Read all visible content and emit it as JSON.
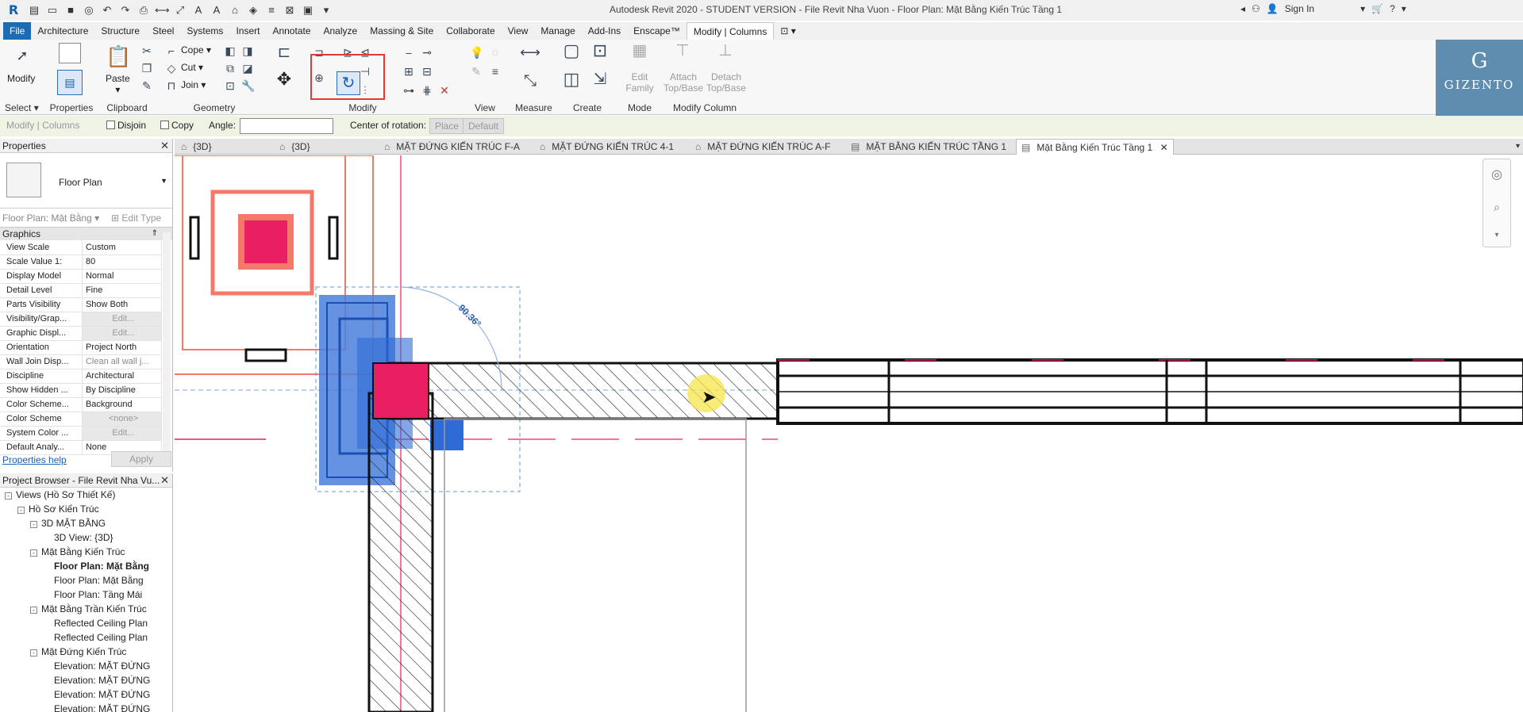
{
  "titlebar": {
    "title": "Autodesk Revit 2020 - STUDENT VERSION - File Revit Nha Vuon - Floor Plan: Mặt Bằng Kiến Trúc Tầng 1",
    "sign_in": "Sign In"
  },
  "menu": {
    "file": "File",
    "tabs": [
      "Architecture",
      "Structure",
      "Steel",
      "Systems",
      "Insert",
      "Annotate",
      "Analyze",
      "Massing & Site",
      "Collaborate",
      "View",
      "Manage",
      "Add-Ins",
      "Enscape™"
    ],
    "active": "Modify | Columns"
  },
  "ribbon": {
    "modify_label": "Modify",
    "paste_label": "Paste",
    "cope_label": "Cope",
    "cut_label": "Cut",
    "join_label": "Join",
    "edit_family_label": "Edit Family",
    "attach_label": "Attach Top/Base",
    "detach_label": "Detach Top/Base",
    "panels": {
      "select": "Select",
      "properties": "Properties",
      "clipboard": "Clipboard",
      "geometry": "Geometry",
      "modify": "Modify",
      "view": "View",
      "measure": "Measure",
      "create": "Create",
      "mode": "Mode",
      "modify_column": "Modify Column"
    }
  },
  "watermark": {
    "mark": "G",
    "name": "GIZENTO"
  },
  "options_bar": {
    "context": "Modify | Columns",
    "disjoin": "Disjoin",
    "copy": "Copy",
    "angle_label": "Angle:",
    "angle_value": "",
    "center_label": "Center of rotation:",
    "place": "Place",
    "default": "Default"
  },
  "properties": {
    "header": "Properties",
    "type_name": "Floor Plan",
    "instance": "Floor Plan: Mặt Bằng",
    "edit_type": "Edit Type",
    "group": "Graphics",
    "rows": [
      {
        "name": "View Scale",
        "value": "Custom"
      },
      {
        "name": "Scale Value    1:",
        "value": "80"
      },
      {
        "name": "Display Model",
        "value": "Normal"
      },
      {
        "name": "Detail Level",
        "value": "Fine"
      },
      {
        "name": "Parts Visibility",
        "value": "Show Both"
      },
      {
        "name": "Visibility/Grap...",
        "value": "Edit..."
      },
      {
        "name": "Graphic Displ...",
        "value": "Edit..."
      },
      {
        "name": "Orientation",
        "value": "Project North"
      },
      {
        "name": "Wall Join Disp...",
        "value": "Clean all wall j..."
      },
      {
        "name": "Discipline",
        "value": "Architectural"
      },
      {
        "name": "Show Hidden ...",
        "value": "By Discipline"
      },
      {
        "name": "Color Scheme...",
        "value": "Background"
      },
      {
        "name": "Color Scheme",
        "value": "<none>"
      },
      {
        "name": "System Color ...",
        "value": "Edit..."
      },
      {
        "name": "Default Analy...",
        "value": "None"
      }
    ],
    "help": "Properties help",
    "apply": "Apply"
  },
  "browser": {
    "header": "Project Browser - File Revit Nha Vu...",
    "items": [
      {
        "label": "Views (Hồ Sơ Thiết Kế)",
        "level": 0,
        "toggle": "-"
      },
      {
        "label": "Hồ Sơ Kiến Trúc",
        "level": 1,
        "toggle": "-"
      },
      {
        "label": "3D MẶT BẰNG",
        "level": 2,
        "toggle": "-"
      },
      {
        "label": "3D View: {3D}",
        "level": 3,
        "toggle": ""
      },
      {
        "label": "Mặt Bằng Kiến Trúc",
        "level": 2,
        "toggle": "-"
      },
      {
        "label": "Floor Plan: Mặt Bằng",
        "level": 3,
        "toggle": "",
        "bold": true
      },
      {
        "label": "Floor Plan: Mặt Bằng",
        "level": 3,
        "toggle": ""
      },
      {
        "label": "Floor Plan: Tầng Mái",
        "level": 3,
        "toggle": ""
      },
      {
        "label": "Mặt Bằng Trần Kiến Trúc",
        "level": 2,
        "toggle": "-"
      },
      {
        "label": "Reflected Ceiling Plan",
        "level": 3,
        "toggle": ""
      },
      {
        "label": "Reflected Ceiling Plan",
        "level": 3,
        "toggle": ""
      },
      {
        "label": "Mặt Đứng Kiến Trúc",
        "level": 2,
        "toggle": "-"
      },
      {
        "label": "Elevation: MẶT ĐỨNG",
        "level": 3,
        "toggle": ""
      },
      {
        "label": "Elevation: MẶT ĐỨNG",
        "level": 3,
        "toggle": ""
      },
      {
        "label": "Elevation: MẶT ĐỨNG",
        "level": 3,
        "toggle": ""
      },
      {
        "label": "Elevation: MẶT ĐỨNG",
        "level": 3,
        "toggle": ""
      }
    ]
  },
  "view_tabs": [
    {
      "label": "{3D}"
    },
    {
      "label": "{3D}"
    },
    {
      "label": "MẶT ĐỨNG KIẾN TRÚC F-A"
    },
    {
      "label": "MẶT ĐỨNG KIẾN TRÚC 4-1"
    },
    {
      "label": "MẶT ĐỨNG KIẾN TRÚC A-F"
    },
    {
      "label": "MẶT BẰNG KIẾN TRÚC TẦNG 1"
    },
    {
      "label": "Mặt Bằng Kiến Trúc Tầng 1",
      "active": true
    }
  ],
  "canvas": {
    "angle_text": "90.36°"
  },
  "colors": {
    "file_tab": "#1f6bb3",
    "column_magenta": "#e91e63",
    "selection_blue": "#2e6bd6",
    "highlight_salmon": "#f4796b",
    "options_bar_bg": "#eef3e4"
  }
}
